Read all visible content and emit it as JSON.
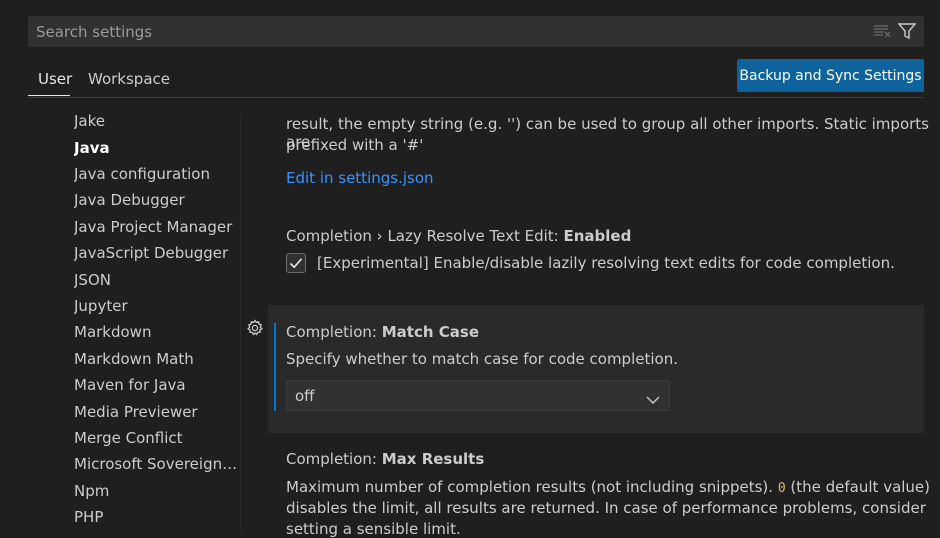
{
  "search": {
    "placeholder": "Search settings"
  },
  "tabs": {
    "user": "User",
    "workspace": "Workspace"
  },
  "sync_button": "Backup and Sync Settings",
  "toc": {
    "items": [
      "Jake",
      "Java",
      "Java configuration",
      "Java Debugger",
      "Java Project Manager",
      "JavaScript Debugger",
      "JSON",
      "Jupyter",
      "Markdown",
      "Markdown Math",
      "Maven for Java",
      "Media Previewer",
      "Merge Conflict",
      "Microsoft Sovereign C...",
      "Npm",
      "PHP"
    ],
    "active": "Java"
  },
  "import_order": {
    "desc_line1": "result, the empty string (e.g. '') can be used to group all other imports. Static imports are",
    "desc_line2": "prefixed with a '#'",
    "edit_link": "Edit in settings.json"
  },
  "lazy_resolve": {
    "category": "Completion › Lazy Resolve Text Edit: ",
    "name": "Enabled",
    "checked": true,
    "checkbox_label": "[Experimental] Enable/disable lazily resolving text edits for code completion."
  },
  "match_case": {
    "category": "Completion: ",
    "name": "Match Case",
    "description": "Specify whether to match case for code completion.",
    "value": "off"
  },
  "max_results": {
    "category": "Completion: ",
    "name": "Max Results",
    "desc_line1_a": "Maximum number of completion results (not including snippets). ",
    "desc_line1_code": "0",
    "desc_line1_b": " (the default value)",
    "desc_line2": "disables the limit, all results are returned. In case of performance problems, consider",
    "desc_line3": "setting a sensible limit."
  },
  "colors": {
    "accent": "#0078d4",
    "button": "#0e639c",
    "link": "#3794ff"
  }
}
